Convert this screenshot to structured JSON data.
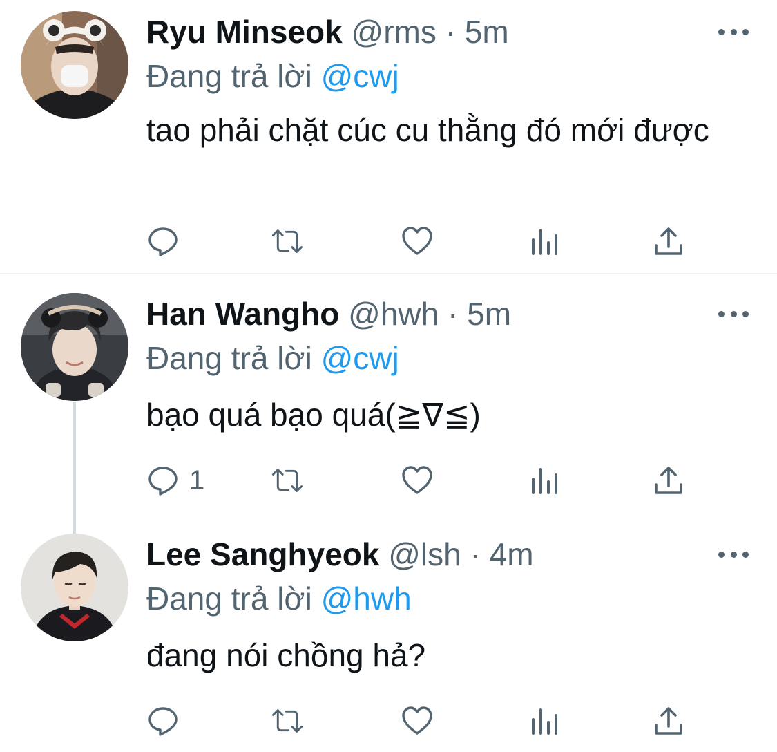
{
  "colors": {
    "text": "#0f1419",
    "secondary": "#536471",
    "link": "#1d9bf0",
    "divider": "#eff3f4",
    "thread_line": "#cfd9de"
  },
  "icons": {
    "reply": "speech-bubble-icon",
    "retweet": "retweet-arrows-icon",
    "like": "heart-icon",
    "analytics": "bar-chart-icon",
    "share": "share-upload-icon",
    "more": "more-dots-icon"
  },
  "tweets": [
    {
      "name": "Ryu Minseok",
      "handle": "@rms",
      "dot": "·",
      "time": "5m",
      "reply_prefix": "Đang trả lời ",
      "reply_to": "@cwj",
      "text": "tao phải chặt cúc cu thằng đó mới được",
      "reply_count": ""
    },
    {
      "name": "Han Wangho",
      "handle": "@hwh",
      "dot": "·",
      "time": "5m",
      "reply_prefix": "Đang trả lời ",
      "reply_to": "@cwj",
      "text": "bạo quá bạo quá(≧∇≦)",
      "reply_count": "1"
    },
    {
      "name": "Lee Sanghyeok",
      "handle": "@lsh",
      "dot": "·",
      "time": "4m",
      "reply_prefix": "Đang trả lời ",
      "reply_to": "@hwh",
      "text": "đang nói chồng hả?",
      "reply_count": ""
    }
  ]
}
